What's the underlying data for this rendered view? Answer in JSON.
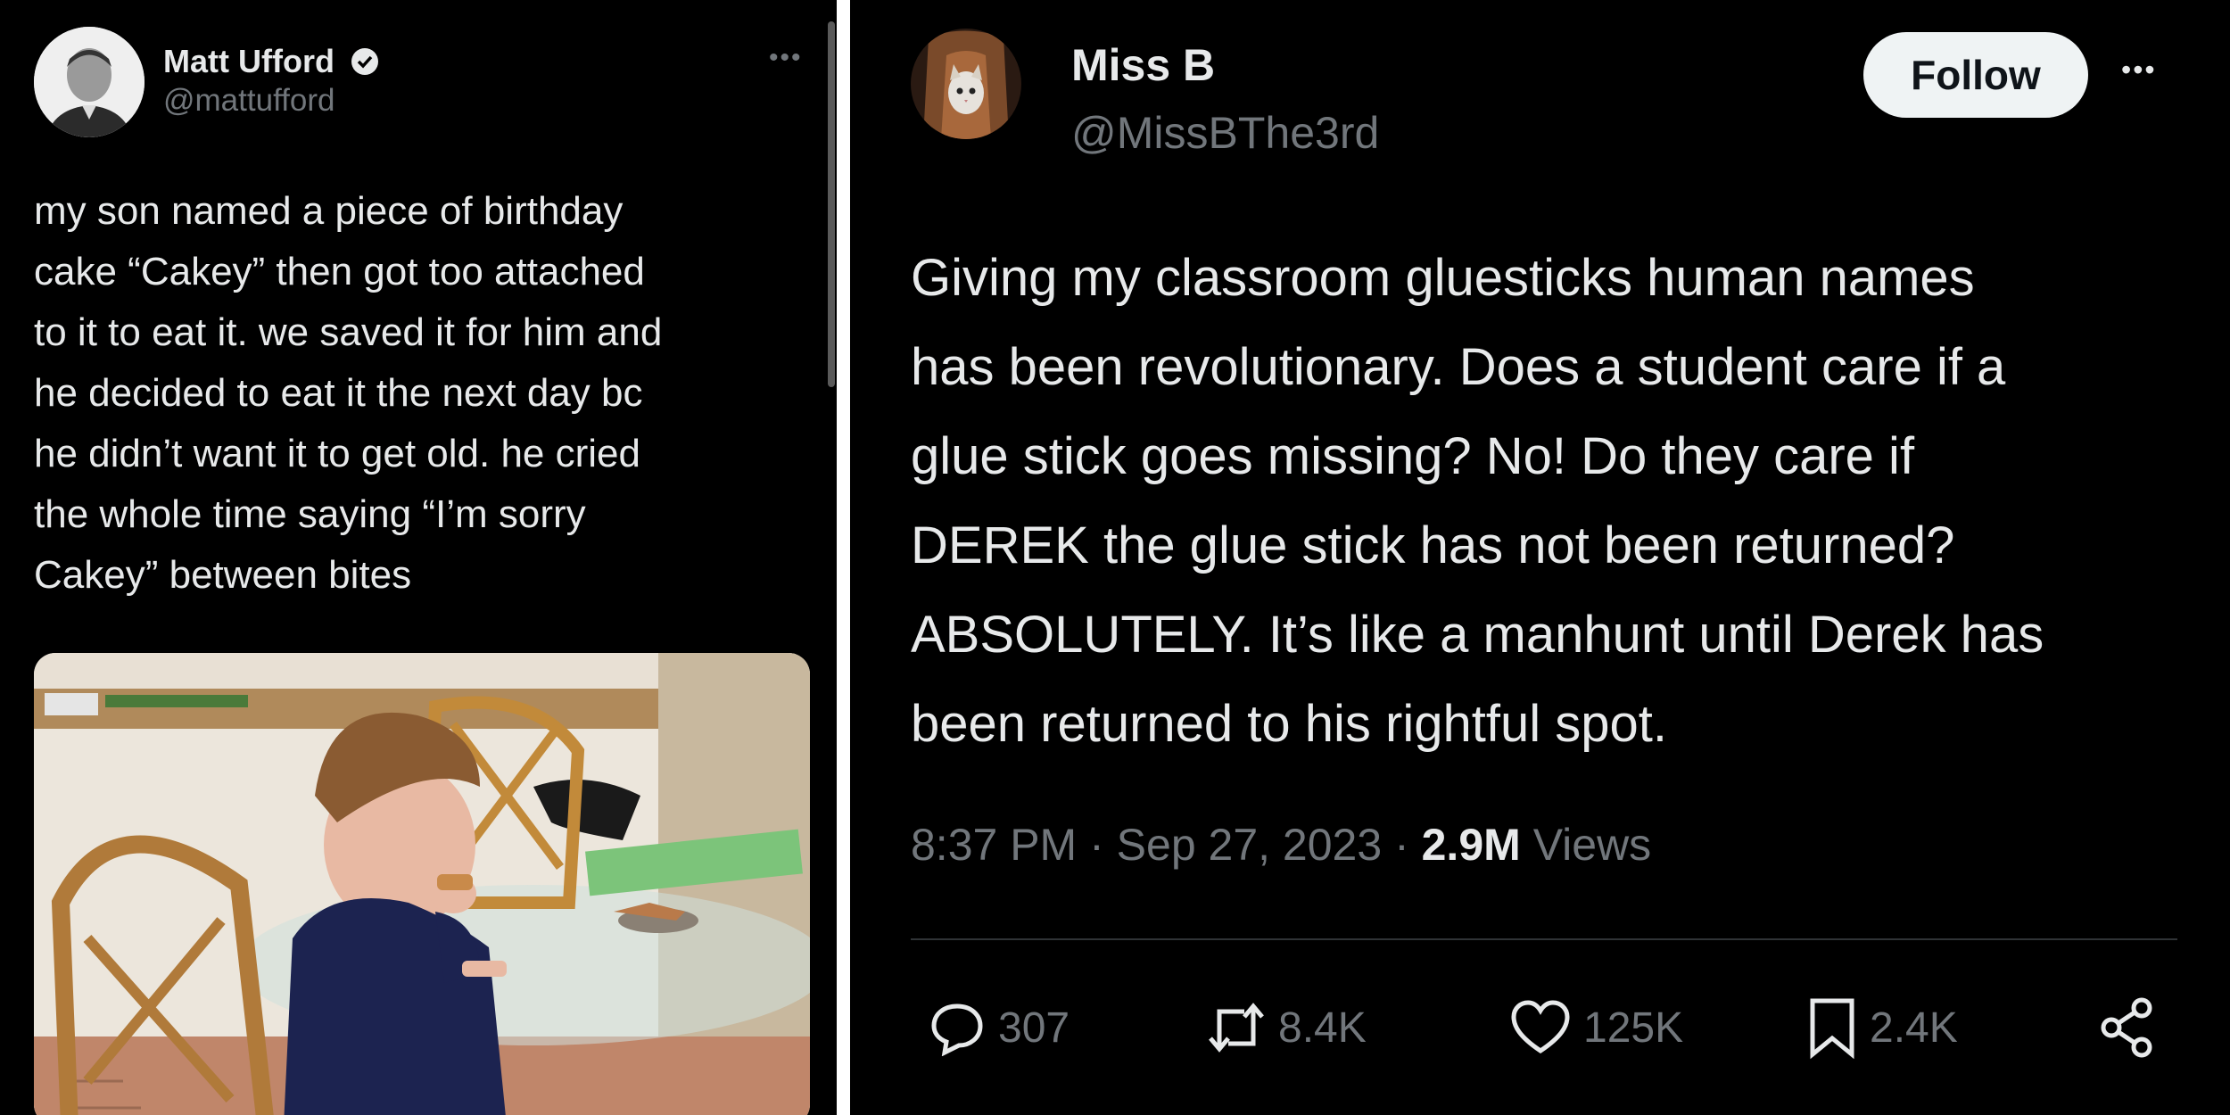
{
  "left_post": {
    "author": {
      "name": "Matt Ufford",
      "handle": "@mattufford",
      "verified": true
    },
    "text": "my son named a piece of birthday\ncake “Cakey” then got too attached\nto it to eat it. we saved it for him and\nhe decided to eat it the next day bc\nhe didn’t want it to get old. he cried\nthe whole time saying “I’m sorry\nCakey” between bites",
    "more_icon": "more-horizontal-icon",
    "photo": "boy eating cake at a glass table"
  },
  "right_post": {
    "author": {
      "name": "Miss B",
      "handle": "@MissBThe3rd"
    },
    "follow_label": "Follow",
    "text": "Giving my classroom gluesticks human names\nhas been revolutionary. Does a student care if a\nglue stick goes missing? No! Do they care if\nDEREK the glue stick has not been returned?\nABSOLUTELY. It’s like a manhunt until Derek has\nbeen returned to his rightful spot.",
    "meta": {
      "time": "8:37 PM",
      "date": "Sep 27, 2023",
      "views_count": "2.9M",
      "views_label": "Views"
    },
    "actions": {
      "replies": "307",
      "reposts": "8.4K",
      "likes": "125K",
      "bookmarks": "2.4K"
    },
    "colors": {
      "background": "#000000",
      "text": "#e7e9ea",
      "secondary": "#71767b"
    }
  }
}
